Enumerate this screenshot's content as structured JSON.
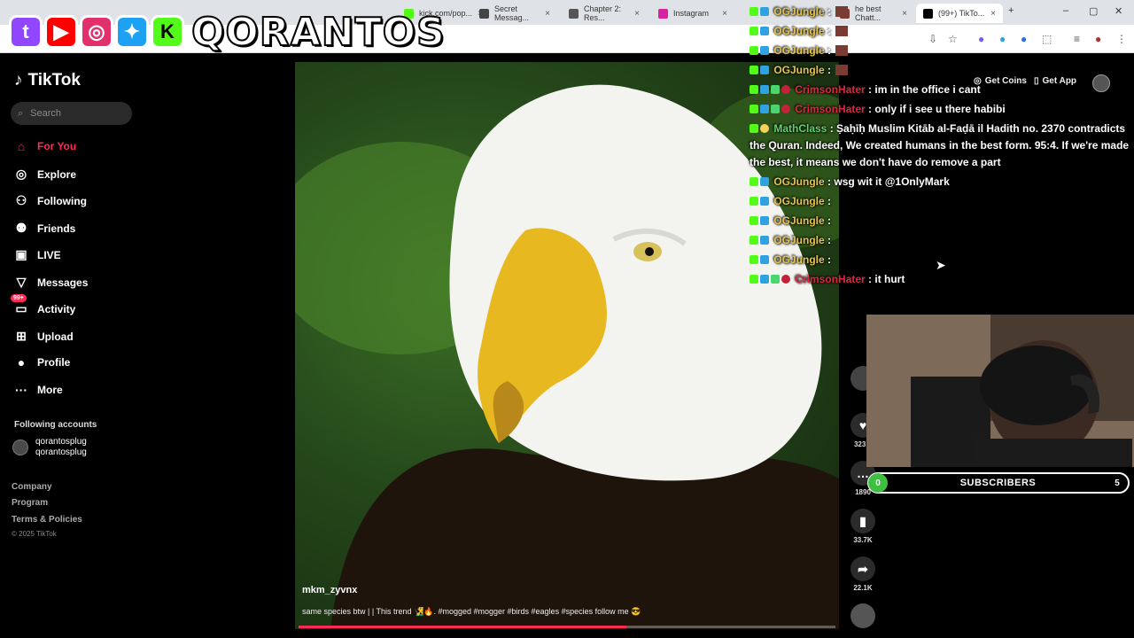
{
  "browser": {
    "tabs": [
      {
        "label": "kick.com/pop...",
        "fav_color": "#53fc18"
      },
      {
        "label": "Secret Messag...",
        "fav_color": "#444444"
      },
      {
        "label": "Chapter 2: Res...",
        "fav_color": "#555555"
      },
      {
        "label": "Instagram",
        "fav_color": "#d6249f"
      },
      {
        "label": "he best Chatt...",
        "fav_color": "#7a3b32"
      },
      {
        "label": "(99+) TikTo...",
        "fav_color": "#000000"
      }
    ]
  },
  "overlay": {
    "brand": "QORANTOS",
    "socials": [
      {
        "name": "twitch",
        "letter": "t",
        "color": "#9146ff"
      },
      {
        "name": "youtube",
        "letter": "▶",
        "color": "#ff0000"
      },
      {
        "name": "instagram",
        "letter": "◎",
        "color": "#e1306c"
      },
      {
        "name": "twitter",
        "letter": "✦",
        "color": "#1da1f2"
      },
      {
        "name": "kick",
        "letter": "K",
        "color": "#53fc18"
      }
    ]
  },
  "tiktok": {
    "logo": "TikTok",
    "search_placeholder": "Search",
    "nav": [
      {
        "label": "For You",
        "icon": "home-icon",
        "active": true
      },
      {
        "label": "Explore",
        "icon": "compass-icon"
      },
      {
        "label": "Following",
        "icon": "following-icon"
      },
      {
        "label": "Friends",
        "icon": "friends-icon"
      },
      {
        "label": "LIVE",
        "icon": "live-icon"
      },
      {
        "label": "Messages",
        "icon": "messages-icon"
      },
      {
        "label": "Activity",
        "icon": "activity-icon",
        "badge": "99+"
      },
      {
        "label": "Upload",
        "icon": "upload-icon"
      },
      {
        "label": "Profile",
        "icon": "profile-icon"
      },
      {
        "label": "More",
        "icon": "more-icon"
      }
    ],
    "following_title": "Following accounts",
    "following": [
      {
        "name": "qorantosplug",
        "handle": "qorantosplug"
      }
    ],
    "footer": [
      "Company",
      "Program",
      "Terms & Policies"
    ],
    "copyright": "© 2025 TikTok",
    "top": {
      "coins": "Get Coins",
      "app": "Get App"
    },
    "video": {
      "username": "mkm_zyvnx",
      "caption": "same species btw | | This trend 🧏‍♂️🔥. #mogged #mogger #birds #eagles #species follow me 😎",
      "progress": 0.61
    },
    "rail": [
      {
        "icon": "heart-icon",
        "count": "323..."
      },
      {
        "icon": "comment-icon",
        "count": "1890"
      },
      {
        "icon": "bookmark-icon",
        "count": "33.7K"
      },
      {
        "icon": "share-icon",
        "count": "22.1K"
      }
    ]
  },
  "chat": {
    "messages": [
      {
        "user": "OGJungle",
        "color": "#e3c44b",
        "text": "",
        "badges": "kb",
        "emote": true
      },
      {
        "user": "OGJungle",
        "color": "#e3c44b",
        "text": "",
        "badges": "kb",
        "emote": true
      },
      {
        "user": "OGJungle",
        "color": "#e3c44b",
        "text": "",
        "badges": "kb",
        "emote": true
      },
      {
        "user": "OGJungle",
        "color": "#e3c44b",
        "text": "",
        "badges": "kb",
        "emote": true
      },
      {
        "user": "CrimsonHater",
        "color": "#e0263f",
        "text": "im in the office i cant",
        "badges": "kbgr"
      },
      {
        "user": "CrimsonHater",
        "color": "#e0263f",
        "text": "only if i see u there habibi",
        "badges": "kbgr"
      },
      {
        "user": "MathClass",
        "color": "#5fd36b",
        "text": "Ṣaḥīḥ Muslim Kitāb al-Faḍā il Hadith no. 2370 contradicts the Quran. Indeed, We created humans in the best form. 95:4. If we're made the best, it means we don't have do remove a part",
        "badges": "km"
      },
      {
        "user": "OGJungle",
        "color": "#e3c44b",
        "text": "wsg wit it @1OnlyMark",
        "badges": "kb"
      },
      {
        "user": "OGJungle",
        "color": "#e3c44b",
        "text": "",
        "badges": "kb"
      },
      {
        "user": "OGJungle",
        "color": "#e3c44b",
        "text": "",
        "badges": "kb"
      },
      {
        "user": "OGJungle",
        "color": "#e3c44b",
        "text": "",
        "badges": "kb"
      },
      {
        "user": "OGJungle",
        "color": "#e3c44b",
        "text": "",
        "badges": "kb"
      },
      {
        "user": "CrimsonHater",
        "color": "#e0263f",
        "text": "it hurt",
        "badges": "kbgr"
      }
    ]
  },
  "subs": {
    "label": "SUBSCRIBERS",
    "count": "0",
    "goal": "5"
  }
}
